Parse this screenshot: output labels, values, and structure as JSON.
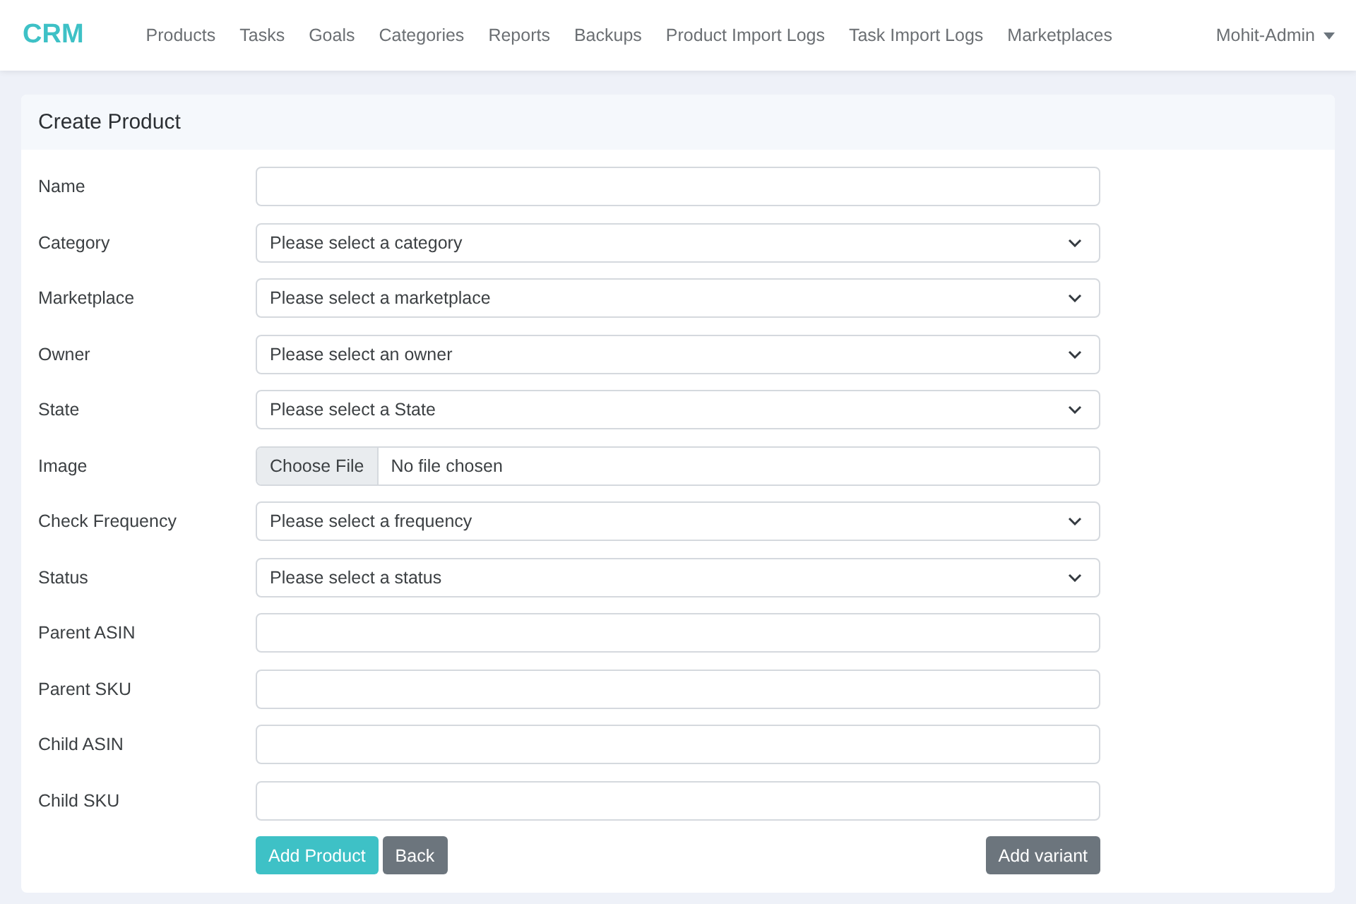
{
  "brand": "CRM",
  "nav": [
    {
      "label": "Products"
    },
    {
      "label": "Tasks"
    },
    {
      "label": "Goals"
    },
    {
      "label": "Categories"
    },
    {
      "label": "Reports"
    },
    {
      "label": "Backups"
    },
    {
      "label": "Product Import Logs"
    },
    {
      "label": "Task Import Logs"
    },
    {
      "label": "Marketplaces"
    }
  ],
  "user_menu": {
    "label": "Mohit-Admin"
  },
  "card": {
    "title": "Create Product"
  },
  "fields": [
    {
      "label": "Name",
      "kind": "text"
    },
    {
      "label": "Category",
      "kind": "select",
      "value": "Please select a category"
    },
    {
      "label": "Marketplace",
      "kind": "select",
      "value": "Please select a marketplace"
    },
    {
      "label": "Owner",
      "kind": "select",
      "value": "Please select an owner"
    },
    {
      "label": "State",
      "kind": "select",
      "value": "Please select a State"
    },
    {
      "label": "Image",
      "kind": "file",
      "button": "Choose File",
      "value": "No file chosen"
    },
    {
      "label": "Check Frequency",
      "kind": "select",
      "value": "Please select a frequency"
    },
    {
      "label": "Status",
      "kind": "select",
      "value": "Please select a status"
    },
    {
      "label": "Parent ASIN",
      "kind": "text"
    },
    {
      "label": "Parent SKU",
      "kind": "text"
    },
    {
      "label": "Child ASIN",
      "kind": "text"
    },
    {
      "label": "Child SKU",
      "kind": "text"
    }
  ],
  "buttons": [
    {
      "label": "Add Product",
      "kind": "primary"
    },
    {
      "label": "Back",
      "kind": "secondary"
    }
  ],
  "side_button": {
    "label": "Add variant",
    "kind": "secondary"
  }
}
